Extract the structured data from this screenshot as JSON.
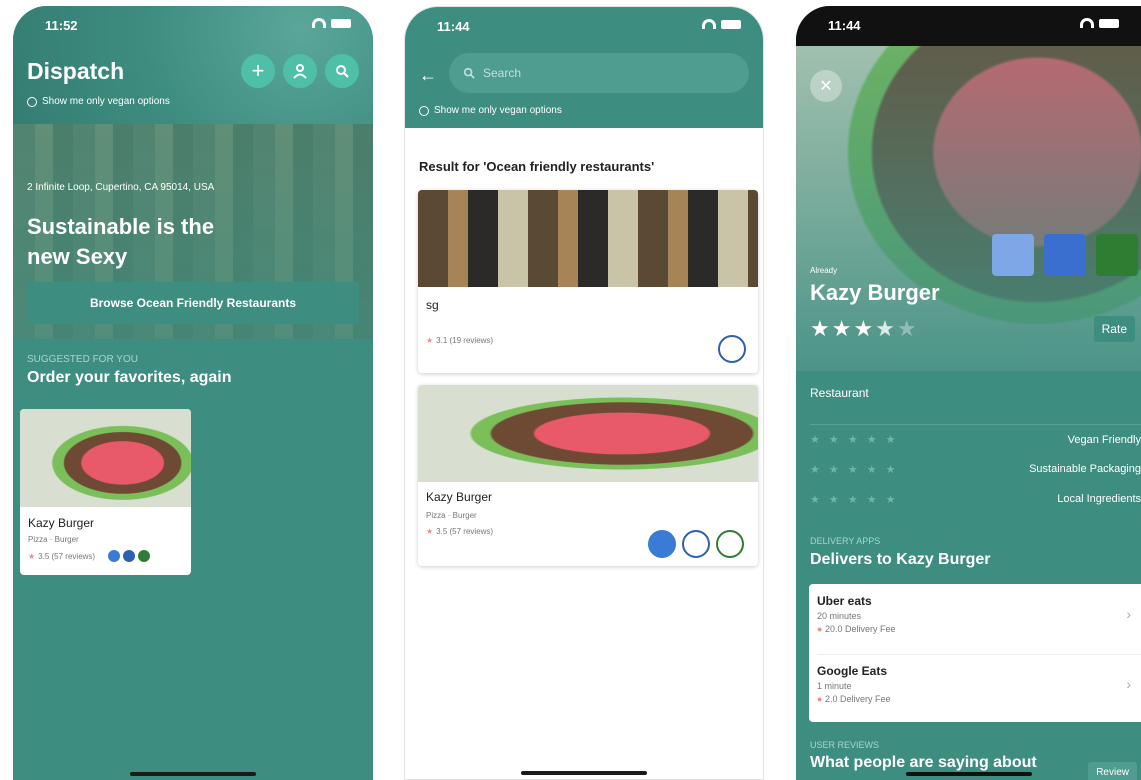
{
  "phone1": {
    "time": "11:52",
    "title": "Dispatch",
    "vegan_option": "Show me only vegan options",
    "address": "2 Infinite Loop, Cupertino, CA 95014, USA",
    "hero_title": "Sustainable is the new Sexy",
    "browse_button": "Browse Ocean Friendly Restaurants",
    "suggested_overline": "SUGGESTED FOR YOU",
    "suggested_title": "Order your favorites, again",
    "card": {
      "name": "Kazy Burger",
      "category": "Pizza · Burger",
      "rating": "3.5 (57 reviews)"
    }
  },
  "phone2": {
    "time": "11:44",
    "search_placeholder": "Search",
    "vegan_option": "Show me only vegan options",
    "result_title": "Result for 'Ocean friendly restaurants'",
    "results": [
      {
        "name": "sg",
        "category": "",
        "rating": "3.1 (19 reviews)"
      },
      {
        "name": "Kazy Burger",
        "category": "Pizza · Burger",
        "rating": "3.5 (57 reviews)"
      }
    ]
  },
  "phone3": {
    "time": "11:44",
    "overline": "Already",
    "name": "Kazy Burger",
    "rating": 3.5,
    "rate_button": "Rate",
    "type_label": "Restaurant",
    "criteria": [
      {
        "label": "Vegan Friendly",
        "stars": "★ ★ ★ ★ ★"
      },
      {
        "label": "Sustainable Packaging",
        "stars": "★ ★ ★ ★ ★"
      },
      {
        "label": "Local Ingredients",
        "stars": "★ ★ ★ ★ ★"
      }
    ],
    "delivery_overline": "DELIVERY APPS",
    "delivery_title": "Delivers to Kazy Burger",
    "apps": [
      {
        "name": "Uber eats",
        "time": "20 minutes",
        "fee": "20.0 Delivery Fee"
      },
      {
        "name": "Google Eats",
        "time": "1 minute",
        "fee": "2.0 Delivery Fee"
      }
    ],
    "reviews_overline": "USER REVIEWS",
    "reviews_title": "What people are saying about",
    "review_button": "Review"
  },
  "colors": {
    "brand": "#3e8d81",
    "accent": "#4fbfa8",
    "star": "#f08b8b"
  }
}
